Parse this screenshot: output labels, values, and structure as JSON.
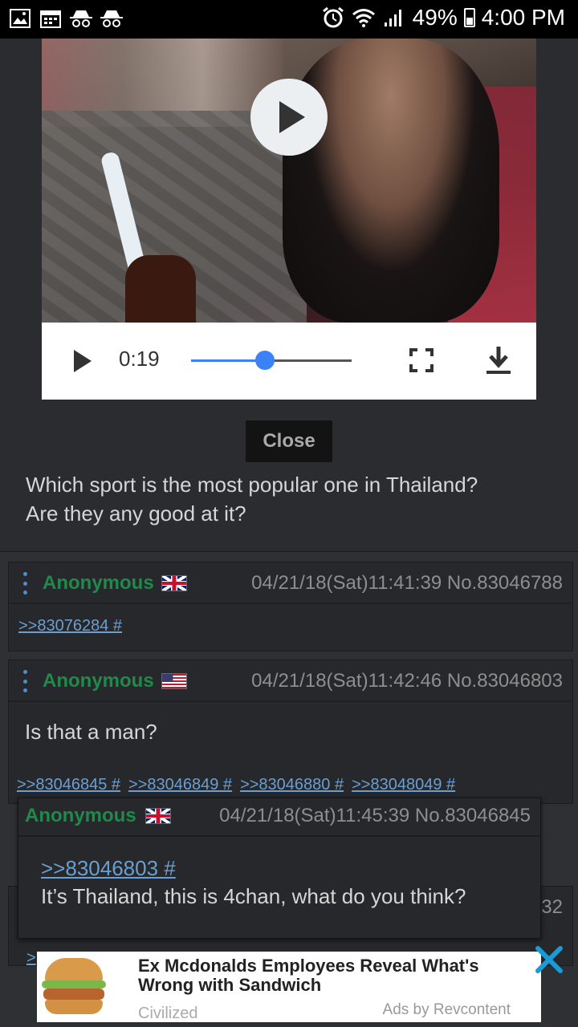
{
  "status_bar": {
    "battery_percent": "49%",
    "time": "4:00 PM",
    "left_icons": [
      "image-icon",
      "calendar-icon",
      "incognito-icon",
      "incognito-icon"
    ],
    "right_icons": [
      "alarm-icon",
      "wifi-icon",
      "signal-icon",
      "battery-icon"
    ]
  },
  "video": {
    "current_time": "0:19",
    "progress": 0.46
  },
  "op": {
    "close_label": "Close",
    "text_line1": "Which sport is the most popular one in Thailand?",
    "text_line2": "Are they any good at it?"
  },
  "replies": [
    {
      "name": "Anonymous",
      "flag": "uk",
      "meta": "04/21/18(Sat)11:41:39 No.83046788",
      "links": [
        ">>83076284 #"
      ],
      "text": ""
    },
    {
      "name": "Anonymous",
      "flag": "us",
      "meta": "04/21/18(Sat)11:42:46 No.83046803",
      "text": "Is that a man?",
      "backlinks": [
        ">>83046845 #",
        ">>83046849 #",
        ">>83046880 #",
        ">>83048049 #"
      ]
    }
  ],
  "partial": {
    "meta_tail": "32",
    "link_tail": ">"
  },
  "popup": {
    "name": "Anonymous",
    "flag": "uk",
    "meta": "04/21/18(Sat)11:45:39 No.83046845",
    "link": ">>83046803 #",
    "text": "It’s Thailand, this is 4chan, what do you think?"
  },
  "ad": {
    "title": "Ex Mcdonalds Employees Reveal What's Wrong with Sandwich",
    "source": "Civilized",
    "provider": "Ads by Revcontent"
  },
  "colors": {
    "background": "#2e3033",
    "name_green": "#1f8a4a",
    "link_blue": "#6b9fd1",
    "accent_blue": "#3b82f6"
  }
}
